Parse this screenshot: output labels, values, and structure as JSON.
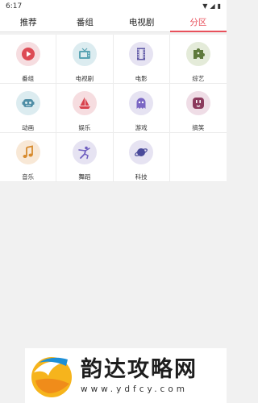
{
  "status": {
    "time": "6:17"
  },
  "tabs": [
    {
      "label": "推荐",
      "active": false
    },
    {
      "label": "番组",
      "active": false
    },
    {
      "label": "电视剧",
      "active": false
    },
    {
      "label": "分区",
      "active": true
    }
  ],
  "categories": [
    {
      "label": "番组",
      "icon": "play-icon",
      "bg": "#f6dde0",
      "fg": "#dd4b55"
    },
    {
      "label": "电视剧",
      "icon": "tv-icon",
      "bg": "#dcecf0",
      "fg": "#5aa4b4"
    },
    {
      "label": "电影",
      "icon": "film-icon",
      "bg": "#e6e3f2",
      "fg": "#5f58a6"
    },
    {
      "label": "综艺",
      "icon": "puzzle-icon",
      "bg": "#e4ebd9",
      "fg": "#5f7a3c"
    },
    {
      "label": "动画",
      "icon": "robot-icon",
      "bg": "#dcecf0",
      "fg": "#4f8ea6"
    },
    {
      "label": "娱乐",
      "icon": "sailboat-icon",
      "bg": "#f6dde0",
      "fg": "#d9434d"
    },
    {
      "label": "游戏",
      "icon": "ghost-icon",
      "bg": "#e6e3f2",
      "fg": "#7b67c4"
    },
    {
      "label": "搞笑",
      "icon": "socket-icon",
      "bg": "#efdde6",
      "fg": "#8c3a5d"
    },
    {
      "label": "音乐",
      "icon": "music-icon",
      "bg": "#f8e8d6",
      "fg": "#d78a2d"
    },
    {
      "label": "舞蹈",
      "icon": "dancer-icon",
      "bg": "#e6e3f2",
      "fg": "#6f5fc0"
    },
    {
      "label": "科技",
      "icon": "planet-icon",
      "bg": "#e6e3f2",
      "fg": "#4a4a9a"
    }
  ],
  "watermark": {
    "title": "韵达攻略网",
    "url": "www.ydfcy.com"
  }
}
